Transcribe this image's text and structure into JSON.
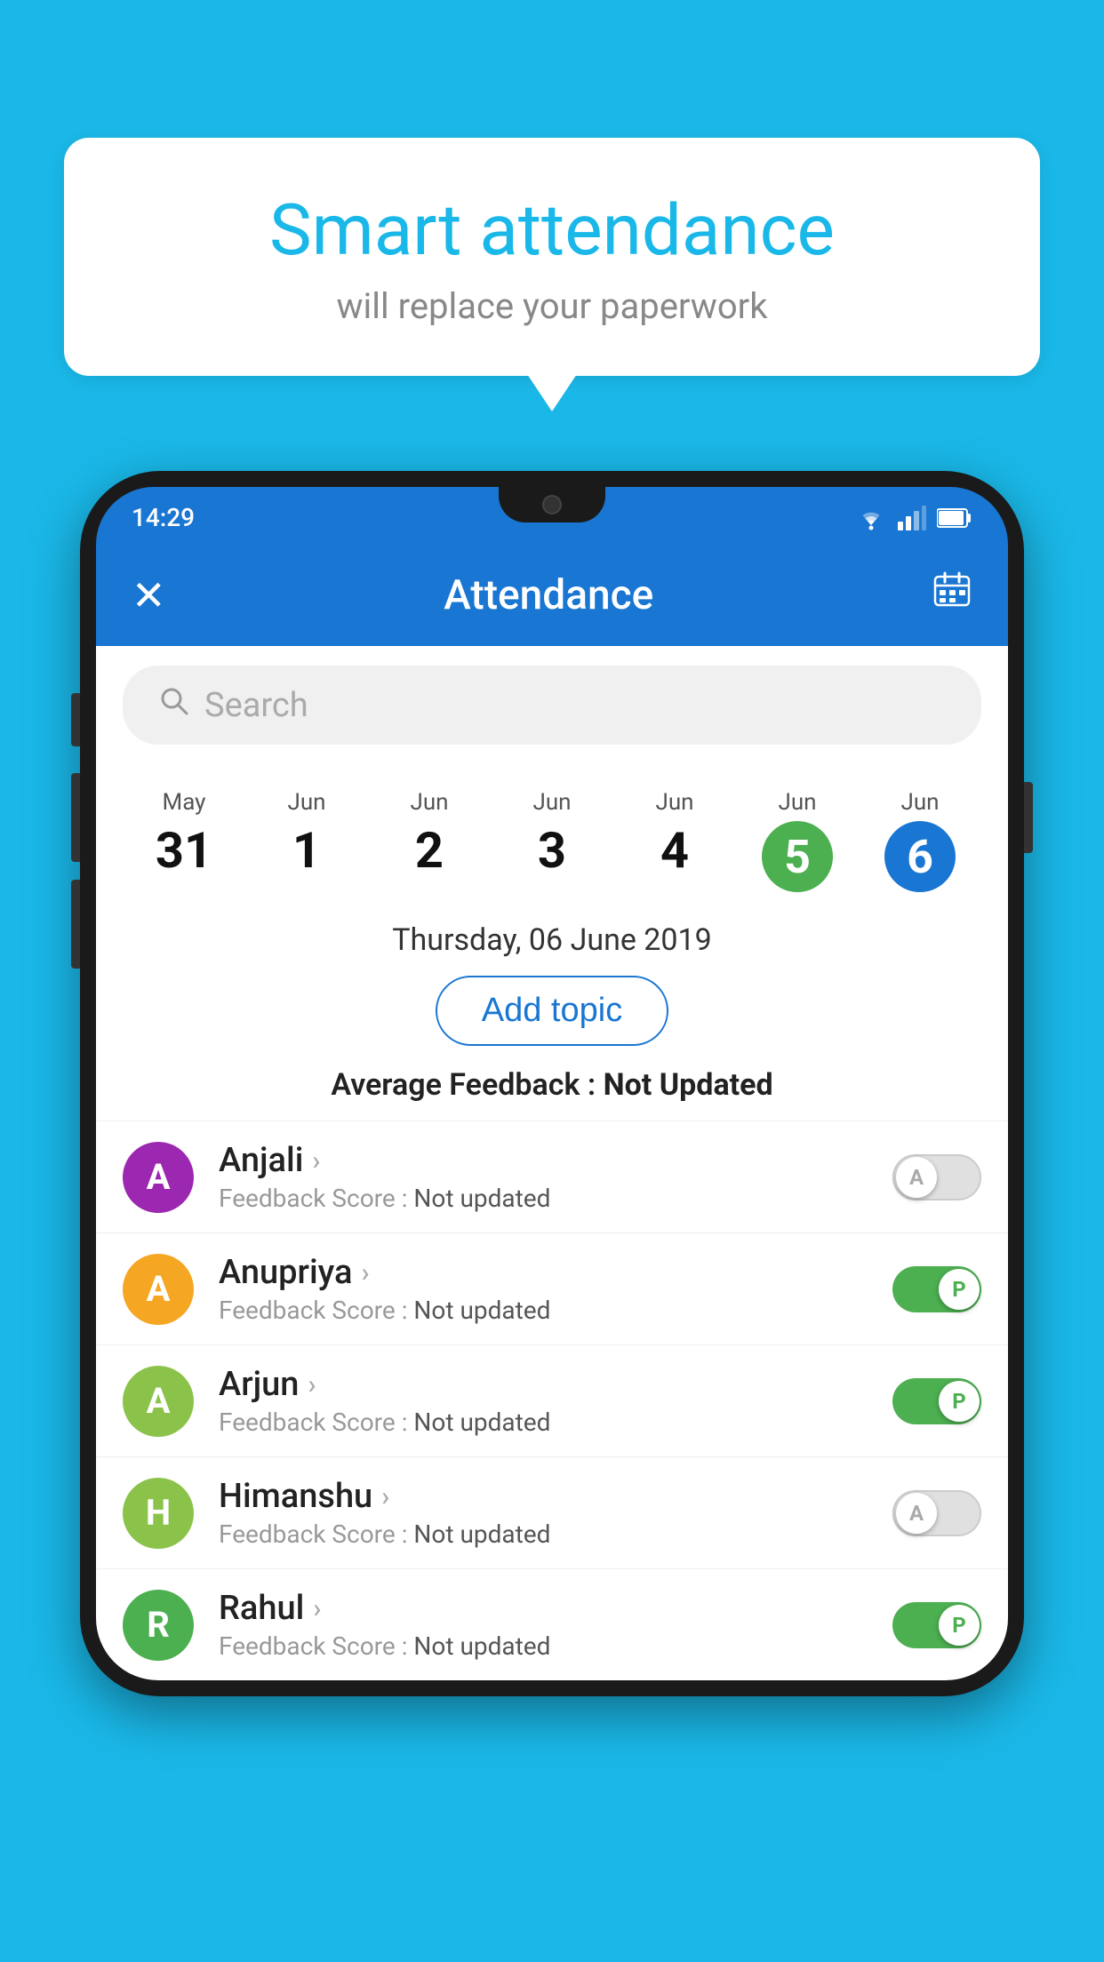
{
  "background_color": "#1ab8e8",
  "bubble": {
    "title": "Smart attendance",
    "subtitle": "will replace your paperwork"
  },
  "status_bar": {
    "time": "14:29",
    "wifi_icon": "wifi",
    "signal_icon": "signal",
    "battery_icon": "battery"
  },
  "app_bar": {
    "close_icon": "✕",
    "title": "Attendance",
    "calendar_icon": "📅"
  },
  "search": {
    "placeholder": "Search"
  },
  "calendar": {
    "dates": [
      {
        "month": "May",
        "day": "31",
        "active": false
      },
      {
        "month": "Jun",
        "day": "1",
        "active": false
      },
      {
        "month": "Jun",
        "day": "2",
        "active": false
      },
      {
        "month": "Jun",
        "day": "3",
        "active": false
      },
      {
        "month": "Jun",
        "day": "4",
        "active": false
      },
      {
        "month": "Jun",
        "day": "5",
        "active": "green"
      },
      {
        "month": "Jun",
        "day": "6",
        "active": "blue"
      }
    ]
  },
  "selected_date_label": "Thursday, 06 June 2019",
  "add_topic_label": "Add topic",
  "avg_feedback": {
    "label": "Average Feedback : ",
    "value": "Not Updated"
  },
  "students": [
    {
      "name": "Anjali",
      "initial": "A",
      "avatar_color": "#9c27b0",
      "feedback_label": "Feedback Score : ",
      "feedback_value": "Not updated",
      "toggle": "off",
      "toggle_letter": "A"
    },
    {
      "name": "Anupriya",
      "initial": "A",
      "avatar_color": "#f5a623",
      "feedback_label": "Feedback Score : ",
      "feedback_value": "Not updated",
      "toggle": "on",
      "toggle_letter": "P"
    },
    {
      "name": "Arjun",
      "initial": "A",
      "avatar_color": "#8bc34a",
      "feedback_label": "Feedback Score : ",
      "feedback_value": "Not updated",
      "toggle": "on",
      "toggle_letter": "P"
    },
    {
      "name": "Himanshu",
      "initial": "H",
      "avatar_color": "#8bc34a",
      "feedback_label": "Feedback Score : ",
      "feedback_value": "Not updated",
      "toggle": "off",
      "toggle_letter": "A"
    },
    {
      "name": "Rahul",
      "initial": "R",
      "avatar_color": "#4caf50",
      "feedback_label": "Feedback Score : ",
      "feedback_value": "Not updated",
      "toggle": "on",
      "toggle_letter": "P"
    }
  ]
}
